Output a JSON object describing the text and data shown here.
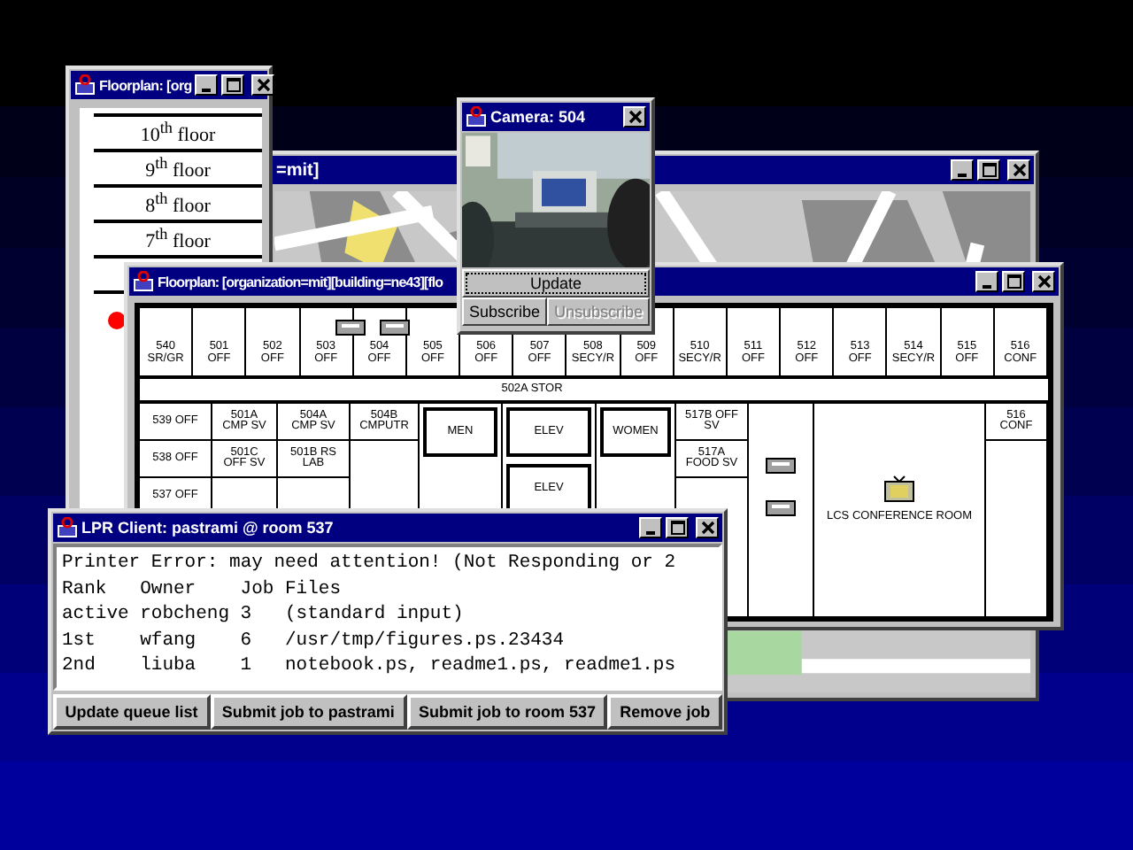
{
  "map_window": {
    "title": "=mit]"
  },
  "floor_window": {
    "title": "Floorplan: [org",
    "floors": [
      "10$^{th}$ floor",
      "9$^{th}$ floor",
      "8$^{th}$ floor",
      "7$^{th}$ floor"
    ]
  },
  "floorplan_window": {
    "title": "Floorplan: [organization=mit][building=ne43][flo",
    "top_rooms": [
      "540 SR/GR",
      "501 OFF",
      "502 OFF",
      "503 OFF",
      "504 OFF",
      "505 OFF",
      "506 OFF",
      "507 OFF",
      "508 SECY/R",
      "509 OFF",
      "510 SECY/R",
      "511 OFF",
      "512 OFF",
      "513 OFF",
      "514 SECY/R",
      "515 OFF",
      "516 CONF"
    ],
    "corridor_label": "502A STOR",
    "lower_columns": [
      {
        "kind": "rooms",
        "rooms": [
          "539 OFF",
          "538 OFF",
          "537 OFF"
        ]
      },
      {
        "kind": "rooms",
        "rooms": [
          "501A CMP SV",
          "501C OFF SV"
        ]
      },
      {
        "kind": "rooms",
        "rooms": [
          "504A CMP SV",
          "501B RS LAB"
        ]
      },
      {
        "kind": "rooms",
        "rooms": [
          "504B CMPUTR"
        ]
      },
      {
        "kind": "core",
        "rooms": [
          "MEN"
        ]
      },
      {
        "kind": "core",
        "rooms": [
          "ELEV",
          "ELEV"
        ]
      },
      {
        "kind": "core",
        "rooms": [
          "WOMEN"
        ]
      },
      {
        "kind": "rooms",
        "rooms": [
          "517B OFF SV",
          "517A FOOD SV"
        ]
      },
      {
        "kind": "equipment"
      },
      {
        "kind": "conference",
        "rooms": [
          "LCS CONFERENCE ROOM"
        ]
      },
      {
        "kind": "rooms",
        "rooms": [
          "516 CONF"
        ]
      }
    ]
  },
  "camera_window": {
    "title": "Camera: 504",
    "buttons": [
      {
        "label": "Update",
        "disabled": false
      },
      {
        "label": "Subscribe",
        "disabled": false
      },
      {
        "label": "Unsubscribe",
        "disabled": true
      }
    ]
  },
  "lpr_window": {
    "title": "LPR Client: pastrami @ room 537",
    "message": "Printer Error: may need attention! (Not Responding or 2",
    "columns": [
      "Rank",
      "Owner",
      "Job",
      "Files"
    ],
    "rows": [
      [
        "active",
        "robcheng",
        "3",
        "(standard input)"
      ],
      [
        "1st",
        "wfang",
        "6",
        "/usr/tmp/figures.ps.23434"
      ],
      [
        "2nd",
        "liuba",
        "1",
        "notebook.ps, readme1.ps, readme1.ps"
      ]
    ],
    "buttons": [
      "Update queue list",
      "Submit job to pastrami",
      "Submit job to room 537",
      "Remove job"
    ]
  }
}
